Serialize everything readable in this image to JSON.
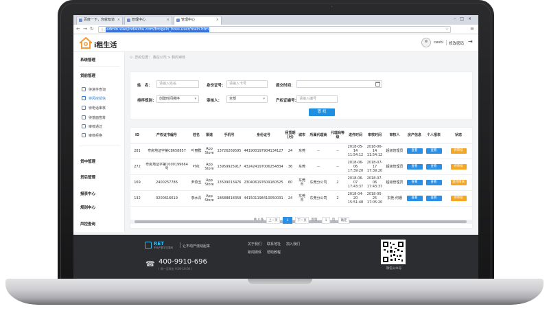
{
  "browser": {
    "tabs": [
      {
        "title": "百度一下，你就知道"
      },
      {
        "title": "管理中心"
      },
      {
        "title": "管理中心"
      }
    ],
    "url": "admin.xianjindaishu.com/hmgein_boss-user/main.htm"
  },
  "header": {
    "brand": "i租生活",
    "user": "ceshi",
    "change_password": "修改密码"
  },
  "sidebar": {
    "groups": [
      {
        "label": "系统管理"
      },
      {
        "label": "贷前管理"
      },
      {
        "label": "贷中管理"
      },
      {
        "label": "贷后管理"
      },
      {
        "label": "报表中心"
      },
      {
        "label": "规则中心"
      },
      {
        "label": "风控查询"
      }
    ],
    "items": [
      {
        "label": "待进件查询"
      },
      {
        "label": "待风控授信"
      },
      {
        "label": "待电话审核"
      },
      {
        "label": "待落面签筹"
      },
      {
        "label": "审核通过"
      },
      {
        "label": "审核拒绝"
      }
    ]
  },
  "breadcrumb": "您的位置： 我在公司 > 我的审核",
  "filters": {
    "name_label": "姓　名：",
    "name_placeholder": "请输入姓名",
    "id_label": "身份证号：",
    "id_placeholder": "请输入卡号",
    "submit_time_label": "提交时间：",
    "sort_label": "排序规则：",
    "sort_value": "创建时间排序",
    "reviewer_label": "审核人：",
    "reviewer_value": "全部",
    "cert_label": "产权证编号：",
    "cert_placeholder": "请输入编号",
    "search": "查 找"
  },
  "table": {
    "columns": [
      "ID",
      "产权证书编号",
      "姓名",
      "渠道",
      "手机号",
      "身份证号",
      "租赁期(月)",
      "城市",
      "所属代理商",
      "代理商等级",
      "进件时间",
      "审核时间",
      "审核人",
      "房产信息",
      "个人报表",
      "状态"
    ],
    "rows": [
      {
        "id": "281",
        "cert": "粤房地证字第C8658857",
        "name": "叶丽群",
        "channel": "App Store",
        "phone": "13726269595",
        "idno": "441900197904134127",
        "term": "24",
        "city": "东莞",
        "agent": "--",
        "level": "--",
        "submit": "2018-05-14 11:54:12",
        "review": "2018-06-14 11:54:12",
        "reviewer": "超级管理员",
        "b1": "查看",
        "b2": "查看",
        "status": "待审核"
      },
      {
        "id": "272",
        "cert": "粤房地证字第1000199664号",
        "name": "叶红",
        "channel": "App Store",
        "phone": "13959925917",
        "idno": "432424197006254834",
        "term": "36",
        "city": "东莞",
        "agent": "--",
        "level": "--",
        "submit": "2018-06-06 17:39:20",
        "review": "2018-07-17 17:39:20",
        "reviewer": "超级管理员",
        "b1": "查看",
        "b2": "查看",
        "status": "待审核"
      },
      {
        "id": "169",
        "cert": "2400257786",
        "name": "尹燕玉",
        "channel": "App Store",
        "phone": "13509013476",
        "idno": "230406197609160525",
        "term": "60",
        "city": "东莞市",
        "agent": "东莞分公司",
        "level": "2",
        "submit": "2018-06-07 17:43:37",
        "review": "2018-07-06 17:43:37",
        "reviewer": "超级管理员",
        "b1": "查看",
        "b2": "查看",
        "status": "退回审核"
      },
      {
        "id": "132",
        "cert": "0200616619",
        "name": "李水青",
        "channel": "App Store",
        "phone": "18688818358",
        "idno": "441501198410050031",
        "term": "24",
        "city": "东莞市",
        "agent": "东莞分公司",
        "level": "2",
        "submit": "2018-04-20 15:51:48",
        "review": "2018-05-25 17:05:20",
        "reviewer": "东莞-何珊",
        "b1": "查看",
        "b2": "查看",
        "status": "待审核"
      }
    ]
  },
  "pager": {
    "total": "共 4 条",
    "prev": "上一页",
    "current": "1",
    "next": "下一页",
    "goto": "到第",
    "page_input": "1",
    "page_unit": "页",
    "confirm": "确定"
  },
  "footer": {
    "brand": "RET",
    "brand_sub": "不动产数字交易网",
    "slogan": "让不动产流动起来",
    "links_row1": [
      "关于我们",
      "联系地址",
      "加入我们"
    ],
    "links_row2": [
      "新闻媒体",
      "帮助教程"
    ],
    "phone": "400-9910-696",
    "hours": "( 周一至周五 9:00-18:00 )",
    "qr_caption": "微信公众号"
  },
  "colors": {
    "primary": "#2b8fe6",
    "warning": "#f5a623",
    "footer_bg": "#2b2d31",
    "brand_orange": "#f29b38"
  }
}
